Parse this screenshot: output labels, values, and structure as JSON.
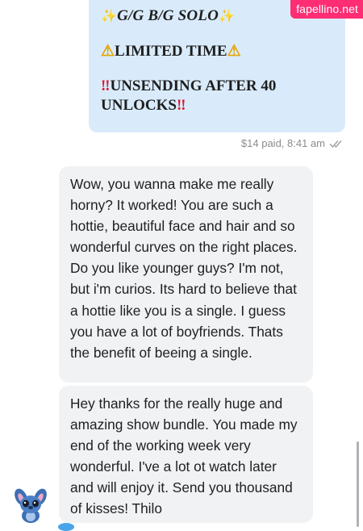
{
  "watermark": "fapellino.net",
  "outgoing_message": {
    "line1": "G/G B/G SOLO",
    "line2": "LIMITED TIME",
    "line3a": "UNSENDING AFTER 40",
    "line3b": "UNLOCKS",
    "meta": "$14 paid, 8:41 am"
  },
  "incoming_messages": [
    {
      "text": "Wow, you wanna make me really horny? It worked! You are such a hottie, beautiful face and hair and so wonderful curves on the right places. Do you like younger guys? I'm not, but i'm curios. Its hard to believe that a hottie like you is a single. I guess you have a lot of boyfriends. Thats the benefit of beeing a single."
    },
    {
      "text": "Hey thanks for the really huge and amazing show bundle. You made my end of the working week very wonderful. I've a lot ot watch later and will enjoy it. Send you thousand of kisses! Thilo"
    }
  ],
  "icons": {
    "read_receipt": "double-check-icon",
    "avatar": "stitch-avatar",
    "sparkle": "sparkles-emoji",
    "warning": "warning-emoji",
    "double_exclamation": "double-exclamation-emoji"
  },
  "colors": {
    "outgoing_bubble": "#d9ebfb",
    "incoming_bubble": "#f0f2f4",
    "watermark_bg": "#ff2d73"
  }
}
